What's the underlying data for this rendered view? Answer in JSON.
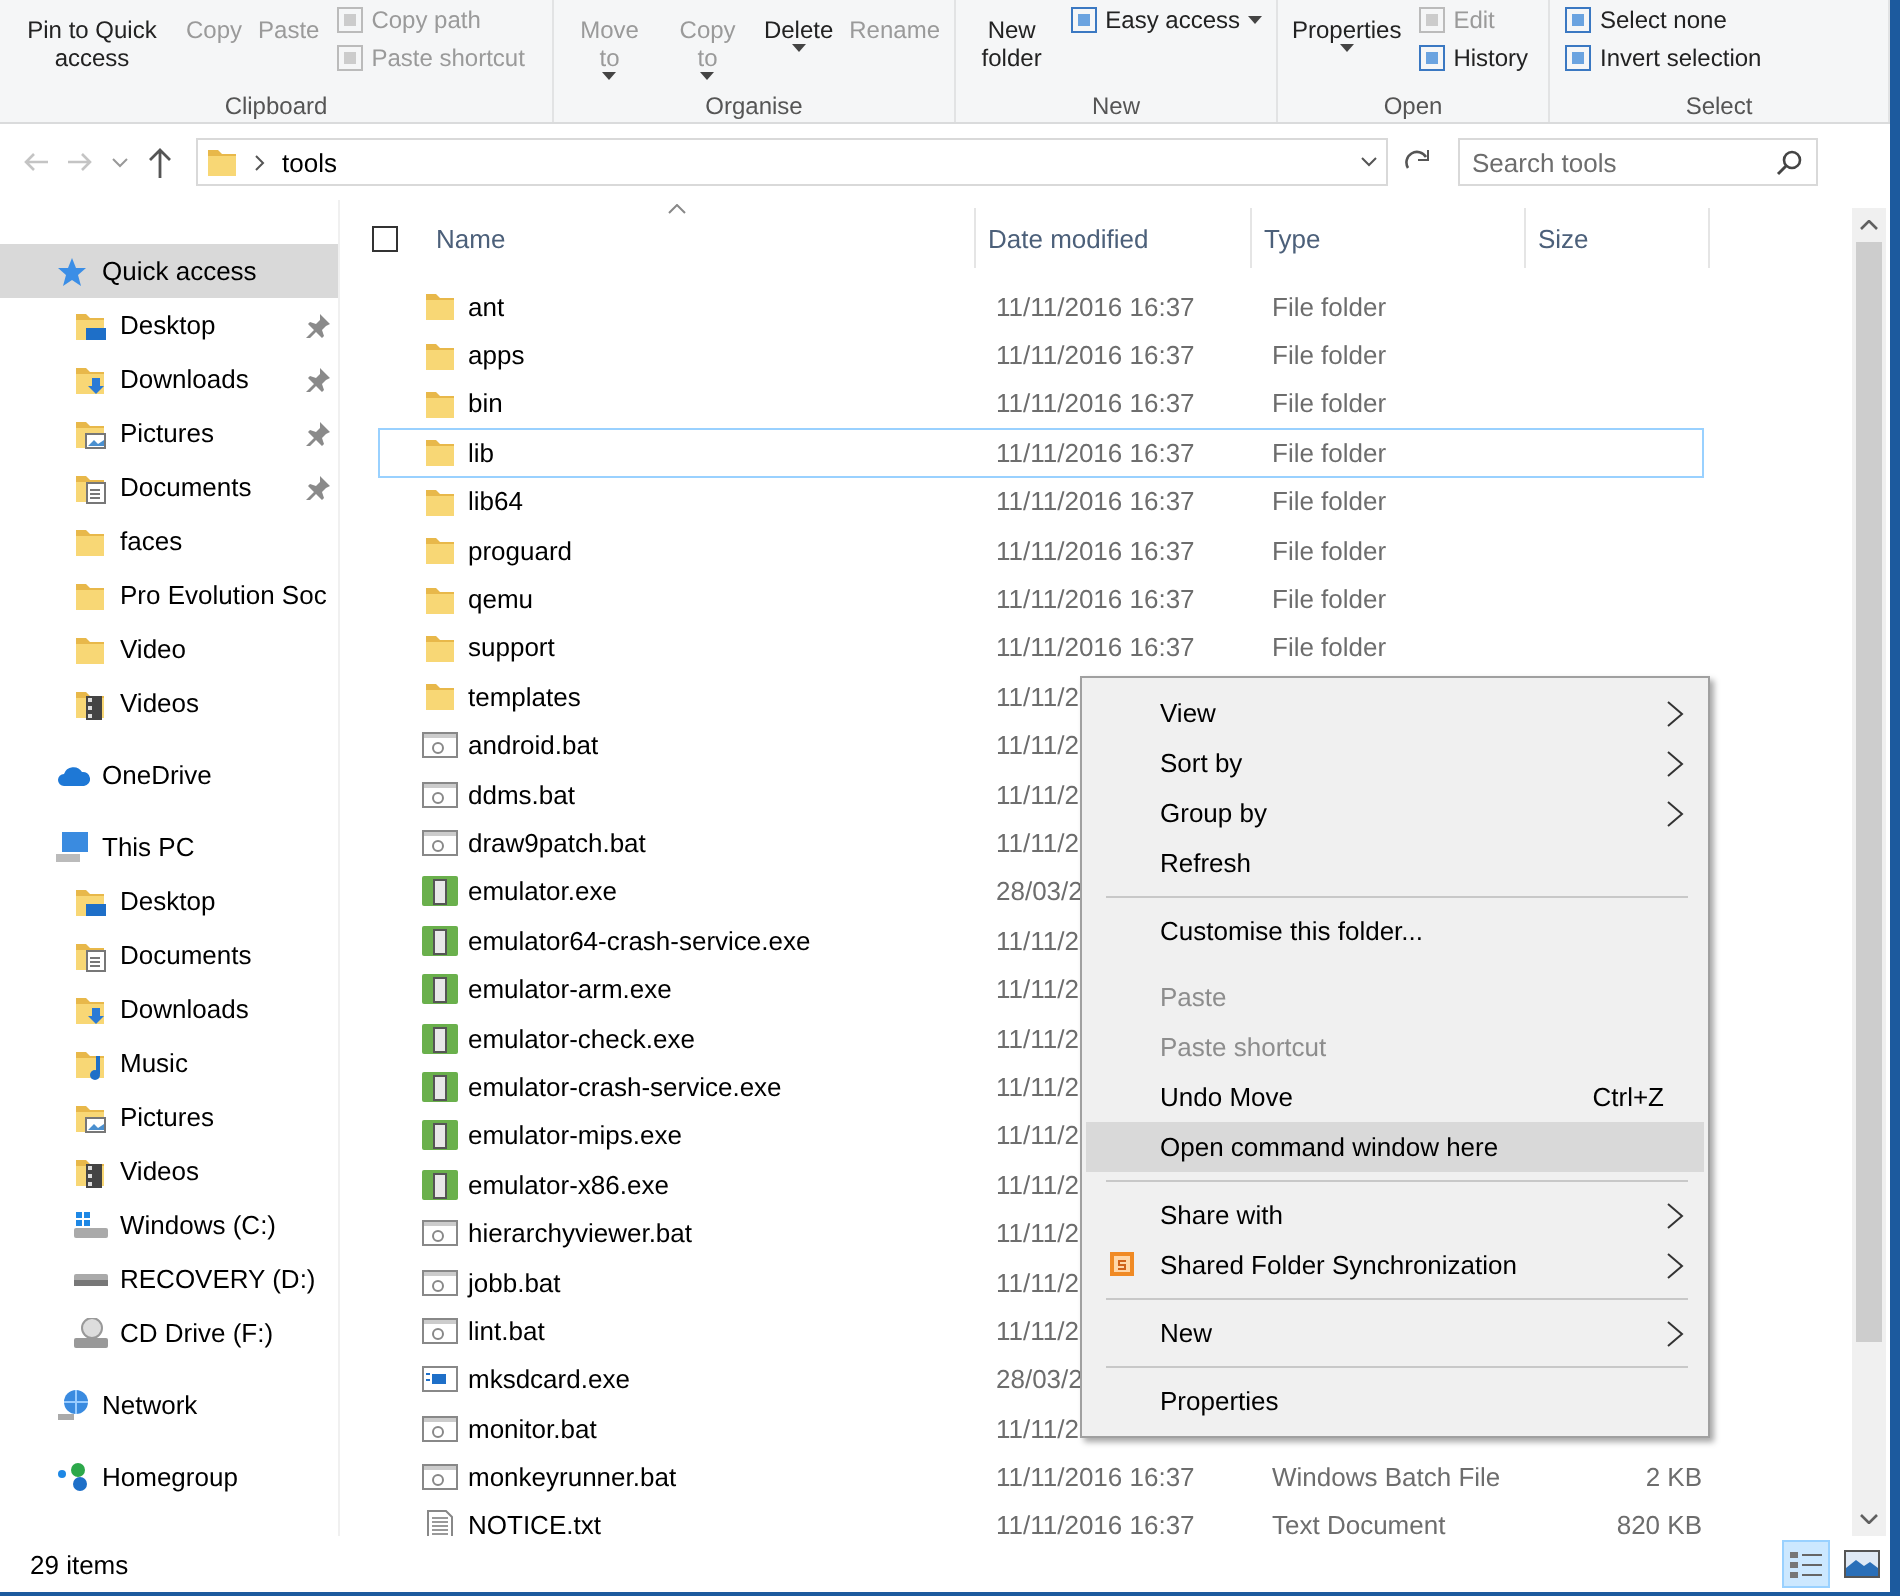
{
  "ribbon": {
    "groups": [
      {
        "label": "Clipboard",
        "buttons": [
          {
            "kind": "large",
            "label": "Pin to Quick access",
            "disabled": false,
            "dropdown": false
          },
          {
            "kind": "large",
            "label": "Copy",
            "disabled": true,
            "dropdown": false
          },
          {
            "kind": "large",
            "label": "Paste",
            "disabled": true,
            "dropdown": false
          },
          {
            "kind": "small",
            "label": "Copy path",
            "disabled": true,
            "dropdown": false
          },
          {
            "kind": "small",
            "label": "Paste shortcut",
            "disabled": true,
            "dropdown": false
          }
        ]
      },
      {
        "label": "Organise",
        "buttons": [
          {
            "kind": "large",
            "label": "Move to",
            "disabled": true,
            "dropdown": true
          },
          {
            "kind": "large",
            "label": "Copy to",
            "disabled": true,
            "dropdown": true
          },
          {
            "kind": "large",
            "label": "Delete",
            "disabled": false,
            "dropdown": true
          },
          {
            "kind": "large",
            "label": "Rename",
            "disabled": true,
            "dropdown": false
          }
        ]
      },
      {
        "label": "New",
        "buttons": [
          {
            "kind": "large",
            "label": "New folder",
            "disabled": false,
            "dropdown": false
          },
          {
            "kind": "small",
            "label": "Easy access",
            "disabled": false,
            "dropdown": true
          }
        ]
      },
      {
        "label": "Open",
        "buttons": [
          {
            "kind": "large",
            "label": "Properties",
            "disabled": false,
            "dropdown": true
          },
          {
            "kind": "small",
            "label": "Edit",
            "disabled": true,
            "dropdown": false
          },
          {
            "kind": "small",
            "label": "History",
            "disabled": false,
            "dropdown": false
          }
        ]
      },
      {
        "label": "Select",
        "buttons": [
          {
            "kind": "small",
            "label": "Select none",
            "disabled": false,
            "dropdown": false
          },
          {
            "kind": "small",
            "label": "Invert selection",
            "disabled": false,
            "dropdown": false
          }
        ]
      }
    ]
  },
  "address_bar": {
    "path": [
      "tools"
    ],
    "search": {
      "placeholder": "Search tools"
    }
  },
  "sidebar": {
    "sections": [
      {
        "label": "Quick access",
        "kind": "star",
        "selected": true,
        "children": [
          {
            "label": "Desktop",
            "kind": "desktop",
            "pinned": true
          },
          {
            "label": "Downloads",
            "kind": "downloads",
            "pinned": true
          },
          {
            "label": "Pictures",
            "kind": "pictures",
            "pinned": true
          },
          {
            "label": "Documents",
            "kind": "documents",
            "pinned": true
          },
          {
            "label": "faces",
            "kind": "folder",
            "pinned": false
          },
          {
            "label": "Pro Evolution Soc",
            "kind": "folder",
            "pinned": false
          },
          {
            "label": "Video",
            "kind": "folder",
            "pinned": false
          },
          {
            "label": "Videos",
            "kind": "videos",
            "pinned": false
          }
        ]
      },
      {
        "label": "OneDrive",
        "kind": "cloud",
        "selected": false
      },
      {
        "label": "This PC",
        "kind": "pc",
        "selected": false,
        "children": [
          {
            "label": "Desktop",
            "kind": "desktop",
            "pinned": false
          },
          {
            "label": "Documents",
            "kind": "documents",
            "pinned": false
          },
          {
            "label": "Downloads",
            "kind": "downloads",
            "pinned": false
          },
          {
            "label": "Music",
            "kind": "music",
            "pinned": false
          },
          {
            "label": "Pictures",
            "kind": "pictures",
            "pinned": false
          },
          {
            "label": "Videos",
            "kind": "videos",
            "pinned": false
          },
          {
            "label": "Windows (C:)",
            "kind": "windrive",
            "pinned": false
          },
          {
            "label": "RECOVERY (D:)",
            "kind": "drive",
            "pinned": false
          },
          {
            "label": "CD Drive (F:)",
            "kind": "cd",
            "pinned": false
          }
        ]
      },
      {
        "label": "Network",
        "kind": "network",
        "selected": false
      },
      {
        "label": "Homegroup",
        "kind": "homegroup",
        "selected": false
      }
    ]
  },
  "files": {
    "select_all": {
      "checked": false
    },
    "columns": [
      "Name",
      "Date modified",
      "Type",
      "Size"
    ],
    "rows": [
      {
        "name": "ant",
        "kind": "folder",
        "date": "11/11/2016 16:37",
        "type": "File folder",
        "focused": false
      },
      {
        "name": "apps",
        "kind": "folder",
        "date": "11/11/2016 16:37",
        "type": "File folder",
        "focused": false
      },
      {
        "name": "bin",
        "kind": "folder",
        "date": "11/11/2016 16:37",
        "type": "File folder",
        "focused": false
      },
      {
        "name": "lib",
        "kind": "folder",
        "date": "11/11/2016 16:37",
        "type": "File folder",
        "focused": true
      },
      {
        "name": "lib64",
        "kind": "folder",
        "date": "11/11/2016 16:37",
        "type": "File folder",
        "focused": false
      },
      {
        "name": "proguard",
        "kind": "folder",
        "date": "11/11/2016 16:37",
        "type": "File folder",
        "focused": false
      },
      {
        "name": "qemu",
        "kind": "folder",
        "date": "11/11/2016 16:37",
        "type": "File folder",
        "focused": false
      },
      {
        "name": "support",
        "kind": "folder",
        "date": "11/11/2016 16:37",
        "type": "File folder",
        "focused": false
      },
      {
        "name": "templates",
        "kind": "folder",
        "date": "11/11/2",
        "focused": false
      },
      {
        "name": "android.bat",
        "kind": "bat",
        "date": "11/11/2",
        "focused": false
      },
      {
        "name": "ddms.bat",
        "kind": "bat",
        "date": "11/11/2",
        "focused": false
      },
      {
        "name": "draw9patch.bat",
        "kind": "bat",
        "date": "11/11/2",
        "focused": false
      },
      {
        "name": "emulator.exe",
        "kind": "exe",
        "date": "28/03/2",
        "focused": false
      },
      {
        "name": "emulator64-crash-service.exe",
        "kind": "exe",
        "date": "11/11/2",
        "focused": false
      },
      {
        "name": "emulator-arm.exe",
        "kind": "exe",
        "date": "11/11/2",
        "focused": false
      },
      {
        "name": "emulator-check.exe",
        "kind": "exe",
        "date": "11/11/2",
        "focused": false
      },
      {
        "name": "emulator-crash-service.exe",
        "kind": "exe",
        "date": "11/11/2",
        "focused": false
      },
      {
        "name": "emulator-mips.exe",
        "kind": "exe",
        "date": "11/11/2",
        "focused": false
      },
      {
        "name": "emulator-x86.exe",
        "kind": "exe",
        "date": "11/11/2",
        "focused": false
      },
      {
        "name": "hierarchyviewer.bat",
        "kind": "bat",
        "date": "11/11/2",
        "focused": false
      },
      {
        "name": "jobb.bat",
        "kind": "bat",
        "date": "11/11/2",
        "focused": false
      },
      {
        "name": "lint.bat",
        "kind": "bat",
        "date": "11/11/2",
        "focused": false
      },
      {
        "name": "mksdcard.exe",
        "kind": "app",
        "date": "28/03/2",
        "focused": false
      },
      {
        "name": "monitor.bat",
        "kind": "bat",
        "date": "11/11/2",
        "focused": false
      },
      {
        "name": "monkeyrunner.bat",
        "kind": "bat",
        "date": "11/11/2016 16:37",
        "type": "Windows Batch File",
        "size": "2 KB",
        "focused": false
      },
      {
        "name": "NOTICE.txt",
        "kind": "txt",
        "date": "11/11/2016 16:37",
        "type": "Text Document",
        "size": "820 KB",
        "focused": false
      }
    ]
  },
  "context_menu": {
    "items": [
      {
        "kind": "item",
        "label": "View",
        "submenu": true,
        "disabled": false,
        "highlighted": false
      },
      {
        "kind": "item",
        "label": "Sort by",
        "submenu": true,
        "disabled": false,
        "highlighted": false
      },
      {
        "kind": "item",
        "label": "Group by",
        "submenu": true,
        "disabled": false,
        "highlighted": false
      },
      {
        "kind": "item",
        "label": "Refresh",
        "submenu": false,
        "disabled": false,
        "highlighted": false
      },
      {
        "kind": "separator"
      },
      {
        "kind": "item",
        "label": "Customise this folder...",
        "submenu": false,
        "disabled": false,
        "highlighted": false
      },
      {
        "kind": "spacer"
      },
      {
        "kind": "item",
        "label": "Paste",
        "submenu": false,
        "disabled": true,
        "highlighted": false
      },
      {
        "kind": "item",
        "label": "Paste shortcut",
        "submenu": false,
        "disabled": true,
        "highlighted": false
      },
      {
        "kind": "item",
        "label": "Undo Move",
        "shortcut": "Ctrl+Z",
        "submenu": false,
        "disabled": false,
        "highlighted": false
      },
      {
        "kind": "item",
        "label": "Open command window here",
        "submenu": false,
        "disabled": false,
        "highlighted": true
      },
      {
        "kind": "separator"
      },
      {
        "kind": "item",
        "label": "Share with",
        "submenu": true,
        "disabled": false,
        "highlighted": false
      },
      {
        "kind": "sync-item",
        "label": "Shared Folder Synchronization",
        "submenu": true,
        "disabled": false,
        "highlighted": false
      },
      {
        "kind": "separator"
      },
      {
        "kind": "item",
        "label": "New",
        "submenu": true,
        "disabled": false,
        "highlighted": false
      },
      {
        "kind": "separator"
      },
      {
        "kind": "item",
        "label": "Properties",
        "submenu": false,
        "disabled": false,
        "highlighted": false
      }
    ]
  },
  "status_bar": {
    "count": "29 items",
    "views": [
      {
        "kind": "details",
        "selected": true
      },
      {
        "kind": "large-icons",
        "selected": false
      }
    ]
  }
}
